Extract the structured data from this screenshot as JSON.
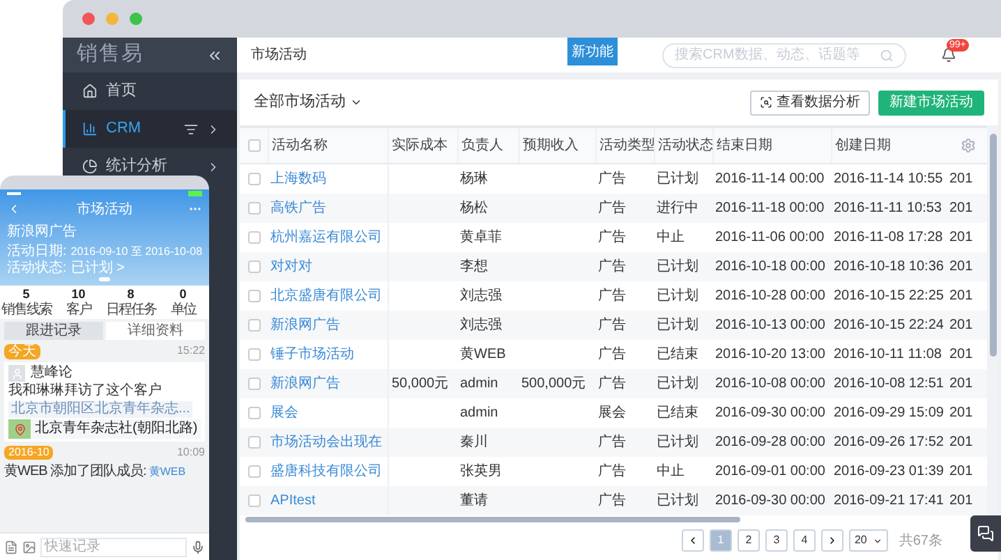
{
  "sidebar": {
    "logo": "销售易",
    "items": [
      {
        "label": "首页",
        "selected": false,
        "arrow": false
      },
      {
        "label": "CRM",
        "selected": true,
        "arrow": true
      },
      {
        "label": "统计分析",
        "selected": false,
        "arrow": true
      }
    ]
  },
  "header": {
    "title": "市场活动",
    "ribbon": "新功能",
    "search": {
      "placeholder": "搜索CRM数据、动态、话题等"
    },
    "badge": "99+"
  },
  "toolbar": {
    "view": "全部市场活动",
    "buttons": [
      {
        "label": "查看数据分析",
        "kind": "outline"
      },
      {
        "label": "新建市场活动",
        "kind": "primary"
      }
    ]
  },
  "table": {
    "all_checked": false,
    "columns": [
      "活动名称",
      "实际成本",
      "负责人",
      "预期收入",
      "活动类型",
      "活动状态",
      "结束日期",
      "创建日期"
    ],
    "rows": [
      {
        "checked": false,
        "cells": [
          "上海数码",
          "",
          "杨琳",
          "",
          "广告",
          "已计划",
          "2016-11-14 00:00",
          "2016-11-14 10:55"
        ],
        "column_10": "201"
      },
      {
        "checked": false,
        "cells": [
          "高铁广告",
          "",
          "杨松",
          "",
          "广告",
          "进行中",
          "2016-11-18 00:00",
          "2016-11-11 10:53"
        ],
        "column_10": "201"
      },
      {
        "checked": false,
        "cells": [
          "杭州嘉运有限公司",
          "",
          "黄卓菲",
          "",
          "广告",
          "中止",
          "2016-11-06 00:00",
          "2016-11-08 17:28"
        ],
        "column_10": "201"
      },
      {
        "checked": false,
        "cells": [
          "对对对",
          "",
          "李想",
          "",
          "广告",
          "已计划",
          "2016-10-18 00:00",
          "2016-10-18 10:36"
        ],
        "column_10": "201"
      },
      {
        "checked": false,
        "cells": [
          "北京盛唐有限公司",
          "",
          "刘志强",
          "",
          "广告",
          "已计划",
          "2016-10-28 00:00",
          "2016-10-15 22:25"
        ],
        "column_10": "201"
      },
      {
        "checked": false,
        "cells": [
          "新浪网广告",
          "",
          "刘志强",
          "",
          "广告",
          "已计划",
          "2016-10-13 00:00",
          "2016-10-15 22:24"
        ],
        "column_10": "201"
      },
      {
        "checked": false,
        "cells": [
          "锤子市场活动",
          "",
          "黄WEB",
          "",
          "广告",
          "已结束",
          "2016-10-20 13:00",
          "2016-10-11 11:08"
        ],
        "column_10": "201"
      },
      {
        "checked": false,
        "cells": [
          "新浪网广告",
          "50,000元",
          "admin",
          "500,000元",
          "广告",
          "已计划",
          "2016-10-08 00:00",
          "2016-10-08 12:51"
        ],
        "column_10": "201"
      },
      {
        "checked": false,
        "cells": [
          "展会",
          "",
          "admin",
          "",
          "展会",
          "已结束",
          "2016-09-30 00:00",
          "2016-09-29 15:09"
        ],
        "column_10": "201"
      },
      {
        "checked": false,
        "cells": [
          "市场活动会出现在",
          "",
          "秦川",
          "",
          "广告",
          "已计划",
          "2016-09-28 00:00",
          "2016-09-26 17:52"
        ],
        "column_10": "201"
      },
      {
        "checked": false,
        "cells": [
          "盛唐科技有限公司",
          "",
          "张英男",
          "",
          "广告",
          "中止",
          "2016-09-01 00:00",
          "2016-09-23 01:39"
        ],
        "column_10": "201"
      },
      {
        "checked": false,
        "cells": [
          "APItest",
          "",
          "董请",
          "",
          "广告",
          "已计划",
          "2016-09-30 00:00",
          "2016-09-21 17:41"
        ],
        "column_10": "201"
      }
    ]
  },
  "pagination": {
    "pages": [
      {
        "label": "1",
        "selected": true
      },
      {
        "label": "2",
        "selected": false
      },
      {
        "label": "3",
        "selected": false
      },
      {
        "label": "4",
        "selected": false
      }
    ],
    "page_size": "20",
    "total": "共67条"
  },
  "phone": {
    "title": "市场活动",
    "name": "新浪网广告",
    "date_label": "活动日期:",
    "date_value": "2016-09-10 至 2016-10-08",
    "status_label": "活动状态:",
    "status_value": "已计划 >",
    "stats": [
      {
        "value": "5",
        "label": "销售线索"
      },
      {
        "value": "10",
        "label": "客户"
      },
      {
        "value": "8",
        "label": "日程任务"
      },
      {
        "value": "0",
        "label": "单位"
      }
    ],
    "tabs": [
      {
        "label": "跟进记录",
        "selected": true
      },
      {
        "label": "详细资料",
        "selected": false
      }
    ],
    "feed": {
      "tag": "今天",
      "time": "15:22",
      "user": "慧峰论",
      "text": "我和琳琳拜访了这个客户",
      "location": "北京市朝阳区北京青年杂志...",
      "place": "北京青年杂志社(朝阳北路)"
    },
    "event": {
      "tag": "2016-10",
      "text": "黄WEB 添加了团队成员:",
      "link": "黄WEB",
      "time": "10:09"
    },
    "input": {
      "placeholder": "快速记录"
    }
  }
}
